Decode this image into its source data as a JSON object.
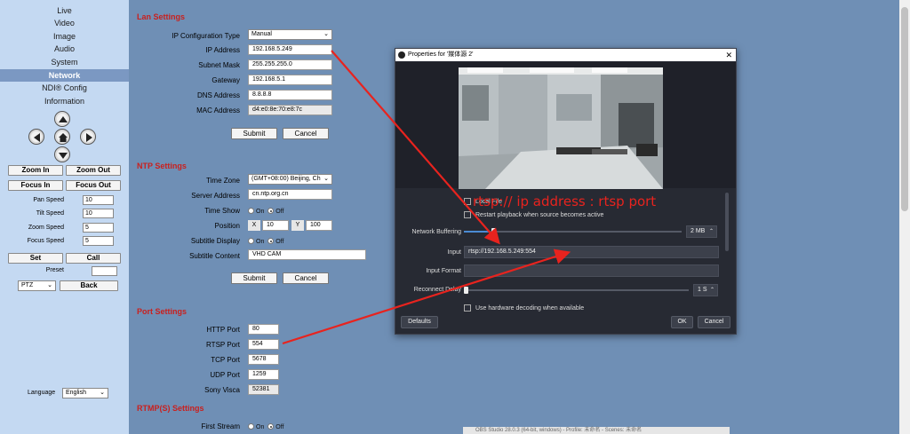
{
  "sidebar": {
    "menu": [
      "Live",
      "Video",
      "Image",
      "Audio",
      "System",
      "Network",
      "NDI® Config",
      "Information"
    ],
    "active": "Network",
    "ptz_buttons": {
      "zoom_in": "Zoom In",
      "zoom_out": "Zoom Out",
      "focus_in": "Focus In",
      "focus_out": "Focus Out",
      "set": "Set",
      "call": "Call",
      "back": "Back"
    },
    "speeds": [
      {
        "label": "Pan Speed",
        "value": "10"
      },
      {
        "label": "Tilt Speed",
        "value": "10"
      },
      {
        "label": "Zoom Speed",
        "value": "5"
      },
      {
        "label": "Focus Speed",
        "value": "5"
      }
    ],
    "preset_label": "Preset",
    "preset_value": "",
    "ptz_select": "PTZ",
    "language_label": "Language",
    "language_value": "English"
  },
  "lan": {
    "title": "Lan Settings",
    "ip_config_label": "IP Configuration Type",
    "ip_config_value": "Manual",
    "ip_label": "IP Address",
    "ip_value": "192.168.5.249",
    "mask_label": "Subnet Mask",
    "mask_value": "255.255.255.0",
    "gateway_label": "Gateway",
    "gateway_value": "192.168.5.1",
    "dns_label": "DNS Address",
    "dns_value": "8.8.8.8",
    "mac_label": "MAC Address",
    "mac_value": "d4:e0:8e:70:e8:7c",
    "submit": "Submit",
    "cancel": "Cancel"
  },
  "ntp": {
    "title": "NTP Settings",
    "tz_label": "Time Zone",
    "tz_value": "(GMT+08:00) Beijing, Ch",
    "server_label": "Server Address",
    "server_value": "cn.ntp.org.cn",
    "timeshow_label": "Time Show",
    "on": "On",
    "off": "Off",
    "position_label": "Position",
    "x_label": "X",
    "x_value": "10",
    "y_label": "Y",
    "y_value": "100",
    "subdisp_label": "Subtitle Display",
    "subcontent_label": "Subtitle Content",
    "subcontent_value": "VHD CAM",
    "submit": "Submit",
    "cancel": "Cancel"
  },
  "port": {
    "title": "Port Settings",
    "http_label": "HTTP Port",
    "http_value": "80",
    "rtsp_label": "RTSP Port",
    "rtsp_value": "554",
    "tcp_label": "TCP Port",
    "tcp_value": "5678",
    "udp_label": "UDP Port",
    "udp_value": "1259",
    "visca_label": "Sony Visca",
    "visca_value": "52381"
  },
  "rtmp": {
    "title": "RTMP(S) Settings",
    "first_stream_label": "First Stream",
    "on": "On",
    "off": "Off"
  },
  "obs": {
    "title": "Properties for '媒体源 2'",
    "local_file": "Local File",
    "restart": "Restart playback when source becomes active",
    "buffering_label": "Network Buffering",
    "buffering_value": "2 MB",
    "input_label": "Input",
    "input_value": "rtsp://192.168.5.249:554",
    "input_format_label": "Input Format",
    "input_format_value": "",
    "reconnect_label": "Reconnect Delay",
    "reconnect_value": "1 S",
    "hw_decode": "Use hardware decoding when available",
    "defaults": "Defaults",
    "ok": "OK",
    "cancel": "Cancel"
  },
  "annotation": "rtsp:// ip address : rtsp port",
  "taskbar_text": "OBS Studio 28.0.3 (64-bit, windows) - Profile: 未命名 - Scenes: 未命名",
  "colors": {
    "accent_red": "#c9201e",
    "annotation_red": "#e8231e",
    "obs_bg": "#272a33",
    "sidebar_bg": "#c4d9f2",
    "main_bg": "#6f8fb5"
  }
}
